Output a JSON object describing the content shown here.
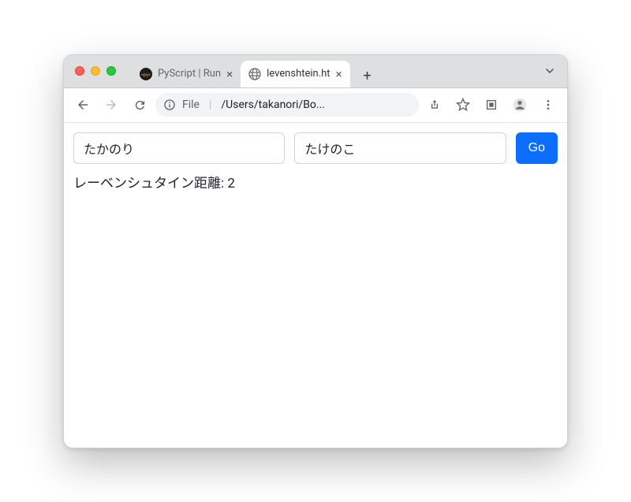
{
  "window": {
    "tabs": [
      {
        "title": "PyScript | Run",
        "active": false
      },
      {
        "title": "levenshtein.ht",
        "active": true
      }
    ],
    "new_tab_label": "+"
  },
  "toolbar": {
    "address": {
      "scheme_label": "File",
      "path": "/Users/takanori/Bo..."
    }
  },
  "page": {
    "input1_value": "たかのり",
    "input2_value": "たけのこ",
    "go_label": "Go",
    "result_text": "レーベンシュタイン距離: 2"
  }
}
